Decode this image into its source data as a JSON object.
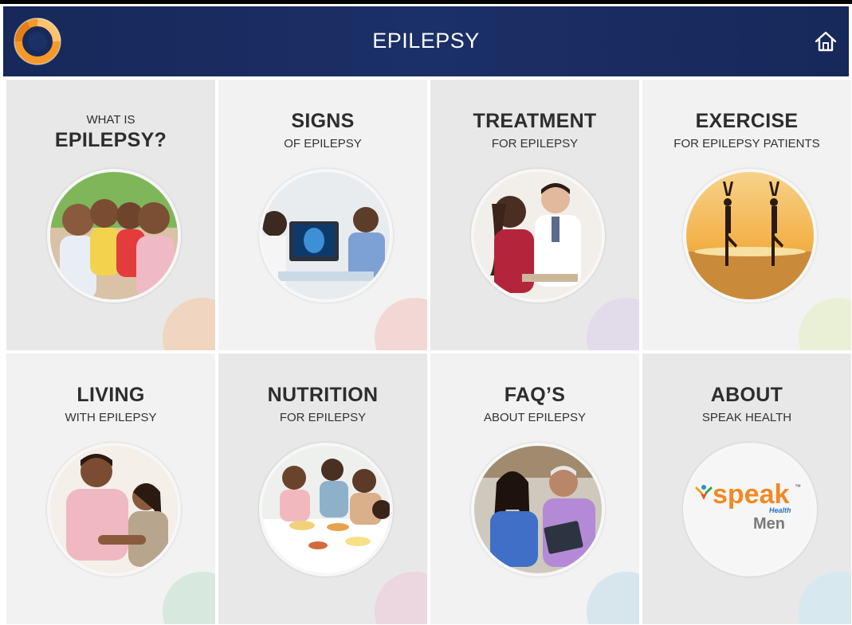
{
  "header": {
    "title": "EPILEPSY",
    "logo_icon": "speak-health-ring-logo",
    "home_icon": "home-icon",
    "bg_color": "#1b2f66"
  },
  "tiles": [
    {
      "id": "what-is",
      "top": "WHAT IS",
      "title": "EPILEPSY?",
      "subtitle": "",
      "image": "family-photo",
      "deco_color": "#f0d6c0"
    },
    {
      "id": "signs",
      "top": "",
      "title": "SIGNS",
      "subtitle": "OF EPILEPSY",
      "image": "doctor-brain-scan-photo",
      "deco_color": "#f2d7d4"
    },
    {
      "id": "treatment",
      "top": "",
      "title": "TREATMENT",
      "subtitle": "FOR EPILEPSY",
      "image": "doctor-consultation-photo",
      "deco_color": "#e2dcea"
    },
    {
      "id": "exercise",
      "top": "",
      "title": "EXERCISE",
      "subtitle": "FOR EPILEPSY PATIENTS",
      "image": "yoga-sunset-photo",
      "deco_color": "#eaf0d6"
    },
    {
      "id": "living",
      "top": "",
      "title": "LIVING",
      "subtitle": "WITH EPILEPSY",
      "image": "couple-photo",
      "deco_color": "#d7e8df"
    },
    {
      "id": "nutrition",
      "top": "",
      "title": "NUTRITION",
      "subtitle": "FOR EPILEPSY",
      "image": "family-meal-photo",
      "deco_color": "#ecd6df"
    },
    {
      "id": "faqs",
      "top": "",
      "title": "FAQ’S",
      "subtitle": "ABOUT EPILEPSY",
      "image": "couple-tablet-photo",
      "deco_color": "#d6e6ec"
    },
    {
      "id": "about",
      "top": "",
      "title": "ABOUT",
      "subtitle": "SPEAK HEALTH",
      "image": "speak-health-men-logo",
      "deco_color": "#d8e8ef"
    }
  ],
  "about_logo": {
    "word": "speak",
    "tag": "Health",
    "line2": "Men",
    "tm": "™"
  }
}
